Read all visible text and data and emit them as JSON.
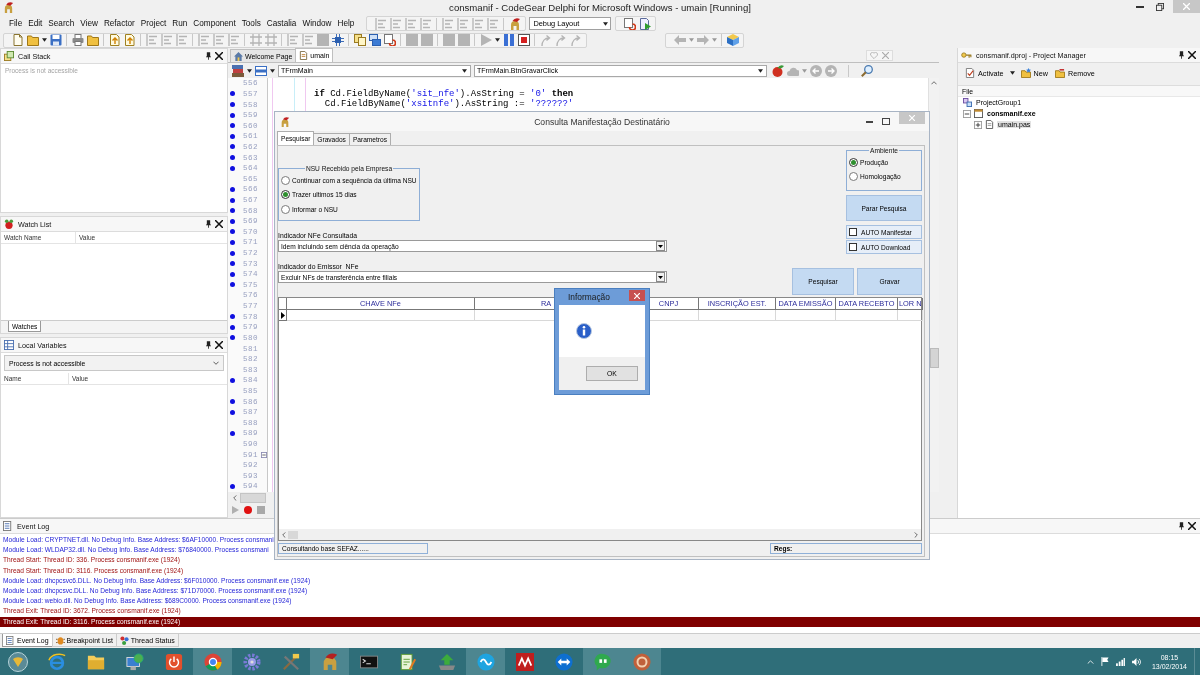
{
  "window": {
    "title": "consmanif - CodeGear Delphi for Microsoft Windows - umain [Running]"
  },
  "menu": [
    "File",
    "Edit",
    "Search",
    "View",
    "Refactor",
    "Project",
    "Run",
    "Component",
    "Tools",
    "Castalia",
    "Window",
    "Help"
  ],
  "toolbar_top": {
    "groups_before": [
      {
        "items": [
          {
            "kind": "lines",
            "disabled": true
          },
          {
            "kind": "lines",
            "disabled": true
          },
          {
            "kind": "lines",
            "disabled": true
          },
          {
            "kind": "lines",
            "disabled": true
          }
        ]
      },
      {
        "items": [
          {
            "kind": "lines",
            "disabled": true
          },
          {
            "kind": "lines",
            "disabled": true
          },
          {
            "kind": "lines",
            "disabled": true
          },
          {
            "kind": "lines",
            "disabled": true
          }
        ]
      },
      {
        "items": [
          {
            "kind": "helmet",
            "disabled": false
          }
        ]
      }
    ],
    "layout": "Debug Layout",
    "groups_after": [
      {
        "items": [
          {
            "kind": "refresh",
            "disabled": false
          },
          {
            "kind": "run-doc",
            "disabled": false
          }
        ]
      }
    ]
  },
  "toolbar_main": {
    "groups": [
      {
        "items": [
          {
            "kind": "page",
            "disabled": false
          },
          {
            "kind": "folder",
            "disabled": false
          },
          {
            "kind": "caret",
            "disabled": false
          },
          {
            "kind": "disk",
            "disabled": false
          }
        ]
      },
      {
        "items": [
          {
            "kind": "printer",
            "disabled": false
          },
          {
            "kind": "folder",
            "disabled": false
          }
        ]
      },
      {
        "items": [
          {
            "kind": "page-arrow",
            "disabled": false
          },
          {
            "kind": "page-arrow",
            "disabled": false
          }
        ]
      },
      {
        "items": [
          {
            "kind": "lines",
            "disabled": true
          },
          {
            "kind": "lines",
            "disabled": true
          },
          {
            "kind": "lines",
            "disabled": true
          }
        ]
      },
      {
        "items": [
          {
            "kind": "lines",
            "disabled": true
          },
          {
            "kind": "lines",
            "disabled": true
          },
          {
            "kind": "lines",
            "disabled": true
          }
        ]
      },
      {
        "items": [
          {
            "kind": "grid",
            "disabled": true
          },
          {
            "kind": "grid",
            "disabled": true
          }
        ]
      },
      {
        "items": [
          {
            "kind": "lines",
            "disabled": true
          },
          {
            "kind": "lines",
            "disabled": true
          },
          {
            "kind": "square",
            "disabled": true
          },
          {
            "kind": "chip",
            "disabled": false
          }
        ]
      },
      {
        "items": [
          {
            "kind": "copy",
            "disabled": false
          },
          {
            "kind": "windows",
            "disabled": false
          },
          {
            "kind": "refresh",
            "disabled": false
          }
        ]
      },
      {
        "items": [
          {
            "kind": "square",
            "disabled": true
          },
          {
            "kind": "square",
            "disabled": true
          }
        ]
      },
      {
        "items": [
          {
            "kind": "square",
            "disabled": true
          },
          {
            "kind": "square",
            "disabled": true
          }
        ]
      },
      {
        "items": [
          {
            "kind": "play",
            "disabled": true
          },
          {
            "kind": "caret",
            "disabled": false
          },
          {
            "kind": "pause",
            "disabled": false
          },
          {
            "kind": "stop",
            "disabled": false
          }
        ]
      },
      {
        "items": [
          {
            "kind": "step",
            "disabled": true
          },
          {
            "kind": "step",
            "disabled": true
          },
          {
            "kind": "step",
            "disabled": true
          }
        ]
      }
    ]
  },
  "navigation": {
    "groups": [
      {
        "items": [
          {
            "kind": "back",
            "disabled": true
          },
          {
            "kind": "caret",
            "disabled": true
          },
          {
            "kind": "forward",
            "disabled": true
          },
          {
            "kind": "caret",
            "disabled": true
          }
        ]
      },
      {
        "items": [
          {
            "kind": "book",
            "disabled": false
          }
        ]
      }
    ]
  },
  "call_stack": {
    "title": "Call Stack",
    "message": "Process is not accessible"
  },
  "watch_list": {
    "title": "Watch List",
    "columns": [
      "Watch Name",
      "Value"
    ],
    "tabs": [
      {
        "label": "Watches",
        "selected": true
      }
    ]
  },
  "local_variables": {
    "title": "Local Variables",
    "frame": "Process is not accessible",
    "columns": [
      "Name",
      "Value"
    ]
  },
  "editor": {
    "tabs": [
      {
        "label": "Welcome Page",
        "kind": "home",
        "selected": false
      },
      {
        "label": "umain",
        "kind": "unit",
        "selected": true
      }
    ],
    "toolbar_left": [
      {
        "kind": "stack",
        "disabled": false
      },
      {
        "kind": "caret",
        "disabled": false
      },
      {
        "kind": "bar",
        "disabled": false
      },
      {
        "kind": "caret",
        "disabled": false
      }
    ],
    "class_combo": "TFrmMain",
    "method_combo": "TFrmMain.BtnGravarClick",
    "toolbar_right": [
      {
        "kind": "berry",
        "disabled": false
      },
      {
        "kind": "cloud",
        "disabled": true
      },
      {
        "kind": "caret",
        "disabled": true
      },
      {
        "kind": "circle-left",
        "disabled": true
      },
      {
        "kind": "circle-right",
        "disabled": true
      },
      {
        "kind": "search",
        "disabled": false
      }
    ],
    "lines": [
      {
        "number": "556",
        "executable": false,
        "fold": false
      },
      {
        "number": "557",
        "executable": true,
        "fold": false,
        "code": [
          {
            "kind": "keyword",
            "text": "if"
          },
          {
            "kind": "plain",
            "text": " Cd.FieldByName("
          },
          {
            "kind": "string",
            "text": "'sit_nfe'"
          },
          {
            "kind": "plain",
            "text": ").AsString = "
          },
          {
            "kind": "string",
            "text": "'0'"
          },
          {
            "kind": "keyword",
            "text": "then"
          }
        ]
      },
      {
        "number": "558",
        "executable": true,
        "fold": false,
        "code": [
          {
            "kind": "plain",
            "text": "  Cd.FieldByName("
          },
          {
            "kind": "string",
            "text": "'xsitnfe'"
          },
          {
            "kind": "plain",
            "text": ").AsString := "
          },
          {
            "kind": "string",
            "text": "'??????'"
          }
        ]
      },
      {
        "number": "559",
        "executable": true,
        "fold": false
      },
      {
        "number": "560",
        "executable": true,
        "fold": false
      },
      {
        "number": "561",
        "executable": true,
        "fold": false
      },
      {
        "number": "562",
        "executable": true,
        "fold": false
      },
      {
        "number": "563",
        "executable": true,
        "fold": false
      },
      {
        "number": "564",
        "executable": true,
        "fold": false
      },
      {
        "number": "565",
        "executable": false,
        "fold": false
      },
      {
        "number": "566",
        "executable": true,
        "fold": false
      },
      {
        "number": "567",
        "executable": true,
        "fold": false
      },
      {
        "number": "568",
        "executable": true,
        "fold": false
      },
      {
        "number": "569",
        "executable": true,
        "fold": false
      },
      {
        "number": "570",
        "executable": true,
        "fold": false
      },
      {
        "number": "571",
        "executable": true,
        "fold": false
      },
      {
        "number": "572",
        "executable": true,
        "fold": false
      },
      {
        "number": "573",
        "executable": true,
        "fold": false
      },
      {
        "number": "574",
        "executable": true,
        "fold": false
      },
      {
        "number": "575",
        "executable": true,
        "fold": false
      },
      {
        "number": "576",
        "executable": false,
        "fold": false
      },
      {
        "number": "577",
        "executable": false,
        "fold": false
      },
      {
        "number": "578",
        "executable": true,
        "fold": false
      },
      {
        "number": "579",
        "executable": true,
        "fold": false
      },
      {
        "number": "580",
        "executable": true,
        "fold": false
      },
      {
        "number": "581",
        "executable": false,
        "fold": false
      },
      {
        "number": "582",
        "executable": false,
        "fold": false
      },
      {
        "number": "583",
        "executable": false,
        "fold": false
      },
      {
        "number": "584",
        "executable": true,
        "fold": false
      },
      {
        "number": "585",
        "executable": false,
        "fold": false
      },
      {
        "number": "586",
        "executable": true,
        "fold": false
      },
      {
        "number": "587",
        "executable": true,
        "fold": false
      },
      {
        "number": "588",
        "executable": false,
        "fold": false
      },
      {
        "number": "589",
        "executable": true,
        "fold": false
      },
      {
        "number": "590",
        "executable": false,
        "fold": false
      },
      {
        "number": "591",
        "executable": false,
        "fold": true
      },
      {
        "number": "592",
        "executable": false,
        "fold": false
      },
      {
        "number": "593",
        "executable": false,
        "fold": false
      },
      {
        "number": "594",
        "executable": true,
        "fold": false
      }
    ]
  },
  "project_manager": {
    "title": "consmanif.dproj - Project Manager",
    "actions": [
      {
        "label": "Activate",
        "kind": "activate"
      },
      {
        "label": "New",
        "kind": "new"
      },
      {
        "label": "Remove",
        "kind": "remove"
      }
    ],
    "column": "File",
    "tree": [
      {
        "label": "ProjectGroup1",
        "kind": "group",
        "active": false,
        "selected": false,
        "children": [
          {
            "label": "consmanif.exe",
            "kind": "project",
            "expanded": true,
            "active": true,
            "selected": false,
            "children": [
              {
                "label": "umain.pas",
                "kind": "unit",
                "expanded": false,
                "active": false,
                "selected": true
              }
            ]
          }
        ]
      }
    ]
  },
  "form": {
    "title": "Consulta Manifestação Destinatário",
    "tabs": [
      {
        "label": "Pesquisar",
        "selected": true
      },
      {
        "label": "Gravados",
        "selected": false
      },
      {
        "label": "Parametros",
        "selected": false
      }
    ],
    "nsu_group": {
      "title": "NSU Recebido pela Empresa",
      "options": [
        {
          "label": "Continuar com a sequência da última NSU",
          "selected": false
        },
        {
          "label": "Trazer ultimos 15 dias",
          "selected": true
        },
        {
          "label": "Informar o NSU",
          "selected": false
        }
      ]
    },
    "environment_group": {
      "title": "Ambiente",
      "options": [
        {
          "label": "Produção",
          "selected": true
        },
        {
          "label": "Homologação",
          "selected": false
        }
      ]
    },
    "stop_button": "Parar Pesquisa",
    "checkboxes": [
      {
        "label": "AUTO Manifestar",
        "checked": false
      },
      {
        "label": "AUTO Download",
        "checked": false
      }
    ],
    "nfe_indicator": {
      "label": "Indicador NFe Consultada",
      "value": "Idem incluindo sem ciência da operação"
    },
    "issuer_indicator": {
      "label": "Indicador do Emissor  NFe",
      "value": "Excluir NFs de transferência entre filiais"
    },
    "buttons": [
      "Pesquisar",
      "Gravar"
    ],
    "grid": {
      "columns": [
        "CHAVE NFe",
        "RA",
        "CNPJ",
        "INSCRIÇÃO EST.",
        "DATA EMISSÃO",
        "DATA RECEBTO",
        "LOR N"
      ]
    },
    "status": [
      "Consultando base SEFAZ......",
      "Regs:"
    ]
  },
  "message_box": {
    "title": "Informação",
    "button": "OK"
  },
  "event_log": {
    "title": "Event Log",
    "entries": [
      {
        "kind": "module",
        "selected": false,
        "text": "Module Load: CRYPTNET.dll. No Debug Info. Base Address: $6AF10000. Process consmani"
      },
      {
        "kind": "module",
        "selected": false,
        "text": "Module Load: WLDAP32.dll. No Debug Info. Base Address: $76840000. Process consmani"
      },
      {
        "kind": "thread",
        "selected": false,
        "text": "Thread Start: Thread ID: 336. Process consmanif.exe (1924)"
      },
      {
        "kind": "thread",
        "selected": false,
        "text": "Thread Start: Thread ID: 3116. Process consmanif.exe (1924)"
      },
      {
        "kind": "module",
        "selected": false,
        "text": "Module Load: dhcpcsvc6.DLL. No Debug Info. Base Address: $6F010000. Process consmanif.exe (1924)"
      },
      {
        "kind": "module",
        "selected": false,
        "text": "Module Load: dhcpcsvc.DLL. No Debug Info. Base Address: $71D70000. Process consmanif.exe (1924)"
      },
      {
        "kind": "module",
        "selected": false,
        "text": "Module Load: webio.dll. No Debug Info. Base Address: $689C0000. Process consmanif.exe (1924)"
      },
      {
        "kind": "thread",
        "selected": false,
        "text": "Thread Exit: Thread ID: 3672. Process consmanif.exe (1924)"
      },
      {
        "kind": "thread",
        "selected": true,
        "text": "Thread Exit: Thread ID: 3116. Process consmanif.exe (1924)"
      }
    ]
  },
  "bottom_tabs": [
    {
      "label": "Event Log",
      "kind": "log",
      "selected": true
    },
    {
      "label": "Breakpoint List",
      "kind": "breakpoints",
      "selected": false
    },
    {
      "label": "Thread Status",
      "kind": "threads",
      "selected": false
    }
  ],
  "taskbar": {
    "apps": [
      {
        "kind": "ring",
        "running": false
      },
      {
        "kind": "folder",
        "running": false
      },
      {
        "kind": "monitor-globe",
        "running": false
      },
      {
        "kind": "power",
        "running": false
      },
      {
        "kind": "segmented-circle",
        "running": true
      },
      {
        "kind": "gear",
        "running": false
      },
      {
        "kind": "tools",
        "running": false
      },
      {
        "kind": "helmet",
        "running": true
      },
      {
        "kind": "terminal",
        "running": false
      },
      {
        "kind": "document-pencil",
        "running": false
      },
      {
        "kind": "arrow-tray",
        "running": false
      },
      {
        "kind": "wave-circle",
        "running": true
      },
      {
        "kind": "zigzag-tile",
        "running": false
      },
      {
        "kind": "double-arrow",
        "running": false
      },
      {
        "kind": "speech-bubble",
        "running": true
      },
      {
        "kind": "ring-badge",
        "running": true
      }
    ],
    "time": "08:15",
    "date": "13/02/2014"
  }
}
